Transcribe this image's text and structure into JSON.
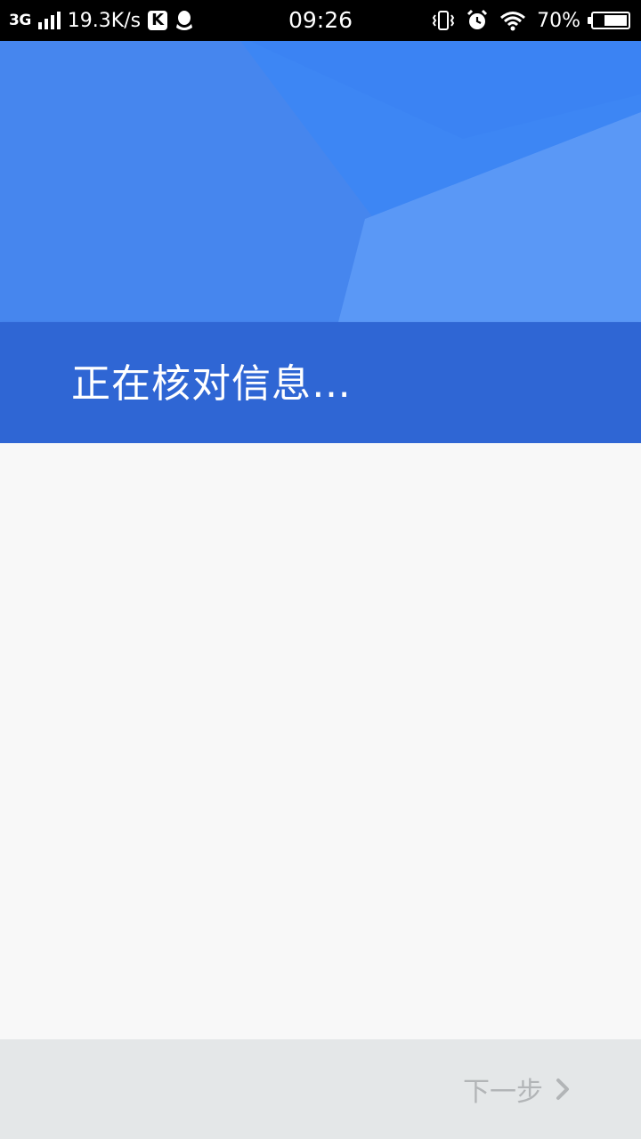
{
  "status_bar": {
    "network_type": "3G",
    "speed": "19.3K/s",
    "k_app_label": "K",
    "time": "09:26",
    "battery_percent": "70%",
    "battery_level": 0.7,
    "icons": [
      "signal-icon",
      "k-app-icon",
      "qq-icon",
      "vibrate-icon",
      "alarm-icon",
      "wifi-icon",
      "battery-icon"
    ]
  },
  "header": {
    "title": "正在核对信息…",
    "colors": {
      "banner": "#4a8cf0",
      "band": "#2f66d4"
    }
  },
  "footer": {
    "next_label": "下一步",
    "next_icon": "chevron-right-icon",
    "text_color": "#b2b5b7",
    "background": "#e4e7e8"
  }
}
